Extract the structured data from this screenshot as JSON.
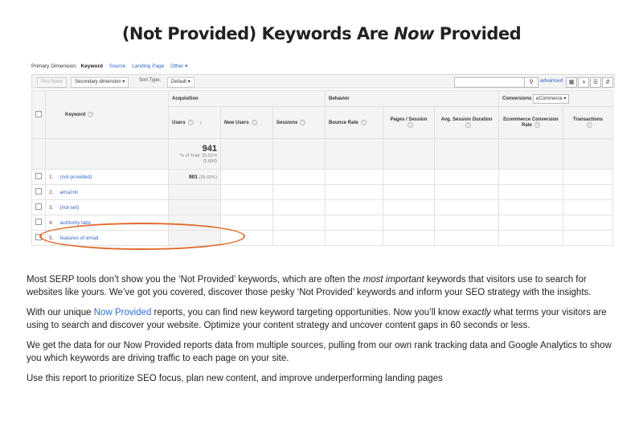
{
  "headline": {
    "part1": "(Not Provided) Keywords Are ",
    "emph": "Now",
    "part2": " Provided"
  },
  "report": {
    "primary_dimension_label": "Primary Dimension:",
    "primary_dimension": "Keyword",
    "dimension_links": [
      "Source",
      "Landing Page",
      "Other"
    ],
    "plot_rows": "Plot Rows",
    "secondary_dimension": "Secondary dimension",
    "sort_type_label": "Sort Type:",
    "sort_type": "Default",
    "advanced": "advanced",
    "search_icon": "magnifier-icon",
    "group_headers": {
      "acquisition": "Acquisition",
      "behavior": "Behavior",
      "conversions": "Conversions",
      "ecommerce": "eCommerce"
    },
    "columns": {
      "keyword": "Keyword",
      "users": "Users",
      "new_users": "New Users",
      "sessions": "Sessions",
      "bounce_rate": "Bounce Rate",
      "pages_session": "Pages / Session",
      "avg_session": "Avg. Session Duration",
      "ecom_rate": "Ecommerce Conversion Rate",
      "transactions": "Transactions"
    },
    "totals": {
      "users": "941",
      "pct_line": "% of Total: 25.51%",
      "abs_line": "(3,689)"
    },
    "rows": [
      {
        "n": "1.",
        "keyword": "(not provided)",
        "users": "901",
        "pct": "(95.65%)"
      },
      {
        "n": "2.",
        "keyword": "amazon"
      },
      {
        "n": "3.",
        "keyword": "(not set)"
      },
      {
        "n": "4.",
        "keyword": "authority labs"
      },
      {
        "n": "5.",
        "keyword": "features of email"
      }
    ],
    "highlight_color": "#e06a2c"
  },
  "paragraphs": {
    "p1": {
      "a": "Most SERP tools don’t show you the ‘Not Provided’ keywords, which are often the ",
      "em": "most important",
      "b": " keywords that visitors use to search for websites like yours. We’ve got you covered, discover those pesky ‘Not Provided’ keywords and inform your SEO strategy with the insights."
    },
    "p2": {
      "a": "With our unique ",
      "link": "Now Provided",
      "b": " reports, you can find new keyword targeting opportunities. Now you’ll know ",
      "em": "exactly",
      "c": " what terms your visitors are using to search and discover your website. Optimize your content strategy and uncover content gaps in 60 seconds or less."
    },
    "p3": "We get the data for our Now Provided reports data from multiple sources, pulling from our own rank tracking data and Google Analytics to show you which keywords are driving traffic to each page on your site.",
    "p4": "Use this report to prioritize SEO focus, plan new content, and improve underperforming landing pages"
  }
}
